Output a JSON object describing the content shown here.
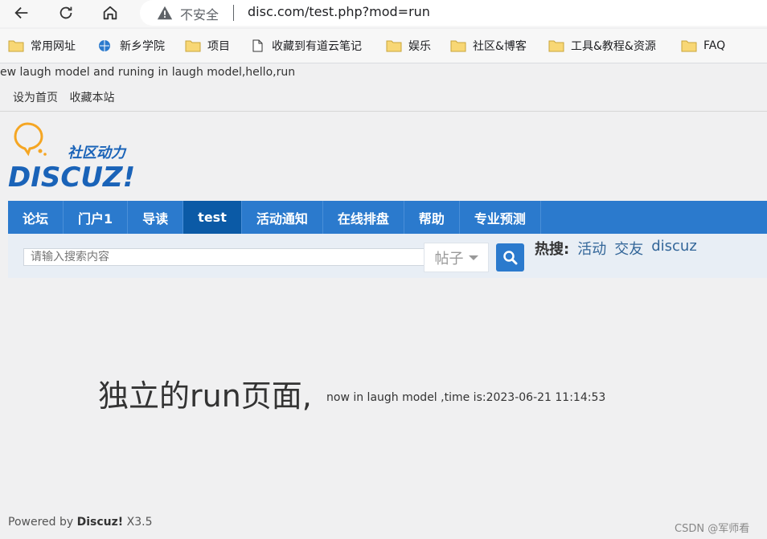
{
  "browser": {
    "insecure_label": "不安全",
    "url": "disc.com/test.php?mod=run",
    "bookmarks": [
      {
        "label": "常用网址",
        "icon": "folder-icon"
      },
      {
        "label": "新乡学院",
        "icon": "globe-icon"
      },
      {
        "label": "项目",
        "icon": "folder-icon"
      },
      {
        "label": "收藏到有道云笔记",
        "icon": "page-icon"
      },
      {
        "label": "娱乐",
        "icon": "folder-icon"
      },
      {
        "label": "社区&博客",
        "icon": "folder-icon"
      },
      {
        "label": "工具&教程&资源",
        "icon": "folder-icon"
      },
      {
        "label": "FAQ",
        "icon": "folder-icon"
      }
    ]
  },
  "page": {
    "marquee": "ew laugh model and runing in laugh model,hello,run",
    "toplinks": [
      "设为首页",
      "收藏本站"
    ],
    "logo": {
      "cn": "社区动力",
      "en": "DISCUZ!"
    },
    "nav": [
      {
        "label": "论坛",
        "active": false
      },
      {
        "label": "门户1",
        "active": false
      },
      {
        "label": "导读",
        "active": false
      },
      {
        "label": "test",
        "active": true
      },
      {
        "label": "活动通知",
        "active": false
      },
      {
        "label": "在线排盘",
        "active": false
      },
      {
        "label": "帮助",
        "active": false
      },
      {
        "label": "专业预测",
        "active": false
      }
    ],
    "search": {
      "placeholder": "请输入搜索内容",
      "type_selected": "帖子",
      "hot_label": "热搜:",
      "hot_links": [
        "活动",
        "交友",
        "discuz"
      ]
    },
    "content": {
      "title": "独立的run页面,",
      "time_text": "now in laugh model ,time is:2023-06-21 11:14:53"
    },
    "footer": {
      "prefix": "Powered by",
      "brand": "Discuz!",
      "version": "X3.5"
    },
    "watermark": "CSDN @军师看"
  },
  "colors": {
    "nav_bg": "#2b7acd",
    "nav_active": "#0b5aa6",
    "logo_blue": "#1a63b8",
    "logo_orange": "#f5a623",
    "hot_link": "#336699"
  }
}
